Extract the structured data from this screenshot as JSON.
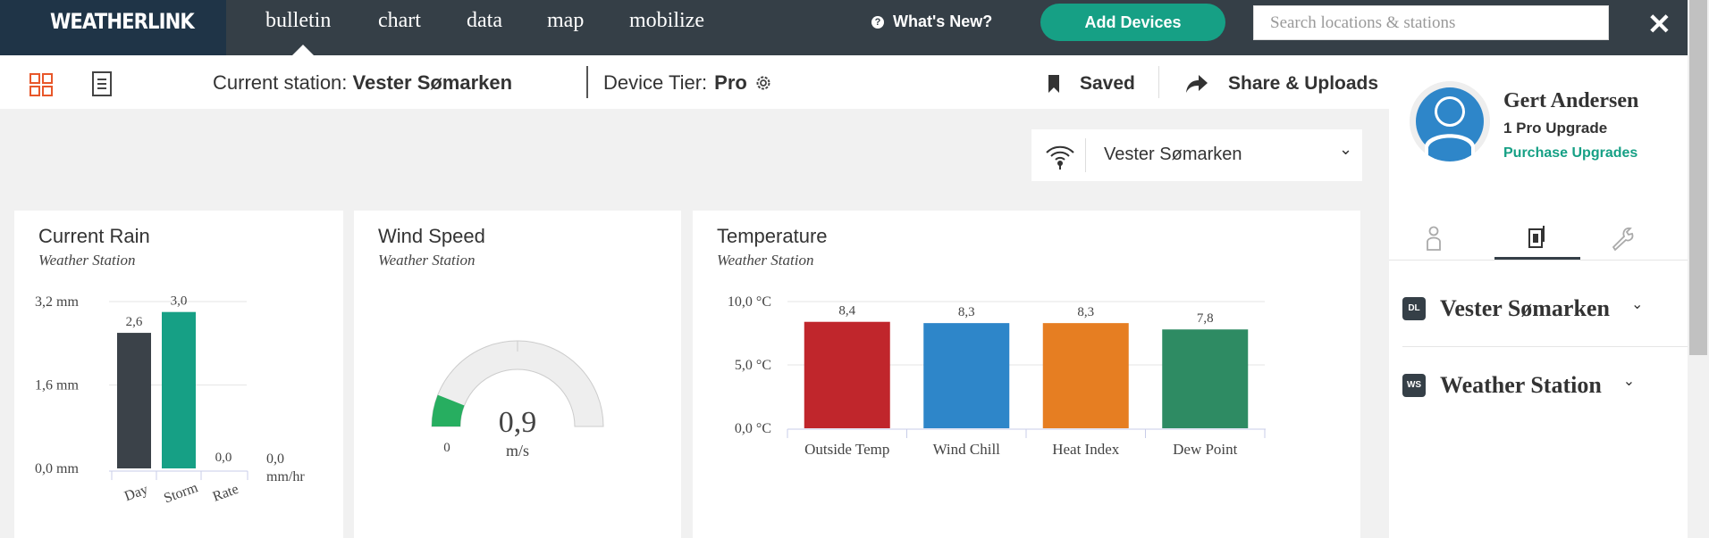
{
  "topbar": {
    "logo": "WEATHERLINK",
    "nav": [
      "bulletin",
      "chart",
      "data",
      "map",
      "mobilize"
    ],
    "whats_new": "What's New?",
    "add_devices": "Add Devices",
    "search_placeholder": "Search locations & stations",
    "close_glyph": "✕"
  },
  "subbar": {
    "current_station_label": "Current station:",
    "current_station_value": "Vester Sømarken",
    "device_tier_label": "Device Tier:",
    "device_tier_value": "Pro",
    "saved": "Saved",
    "share": "Share & Uploads"
  },
  "station_select": {
    "value": "Vester Sømarken",
    "chevron": "⌄"
  },
  "cards": {
    "rain": {
      "title": "Current Rain",
      "subtitle": "Weather Station"
    },
    "wind": {
      "title": "Wind Speed",
      "subtitle": "Weather Station"
    },
    "temp": {
      "title": "Temperature",
      "subtitle": "Weather Station"
    }
  },
  "chart_data": [
    {
      "type": "bar",
      "title": "Current Rain",
      "categories": [
        "Day",
        "Storm",
        "Rate"
      ],
      "values": [
        2.6,
        3.0,
        0.0
      ],
      "value_labels": [
        "2,6",
        "3,0",
        "0,0"
      ],
      "yticks": [
        "3,2 mm",
        "1,6 mm",
        "0,0 mm"
      ],
      "ylim": [
        0,
        3.2
      ],
      "side_value": "0,0",
      "side_unit": "mm/hr",
      "colors": [
        "#3b4249",
        "#16a085",
        "#3b4249"
      ]
    },
    {
      "type": "gauge",
      "title": "Wind Speed",
      "value": 0.9,
      "value_label": "0,9",
      "unit": "m/s",
      "min_label": "0",
      "color": "#27ae60"
    },
    {
      "type": "bar",
      "title": "Temperature",
      "categories": [
        "Outside Temp",
        "Wind Chill",
        "Heat Index",
        "Dew Point"
      ],
      "values": [
        8.4,
        8.3,
        8.3,
        7.8
      ],
      "value_labels": [
        "8,4",
        "8,3",
        "8,3",
        "7,8"
      ],
      "yticks": [
        "10,0 °C",
        "5,0 °C",
        "0,0 °C"
      ],
      "ylim": [
        0,
        10
      ],
      "colors": [
        "#c0262c",
        "#2e86c9",
        "#e67e22",
        "#2e8b63"
      ]
    }
  ],
  "user": {
    "name": "Gert Andersen",
    "plan": "1 Pro Upgrade",
    "purchase": "Purchase Upgrades"
  },
  "devices": [
    {
      "badge": "DL",
      "name": "Vester Sømarken"
    },
    {
      "badge": "WS",
      "name": "Weather Station"
    }
  ],
  "colors": {
    "accent": "#16a085",
    "topbar": "#353f47",
    "logo_bg": "#1f3447",
    "grid_icon": "#e8572a"
  }
}
